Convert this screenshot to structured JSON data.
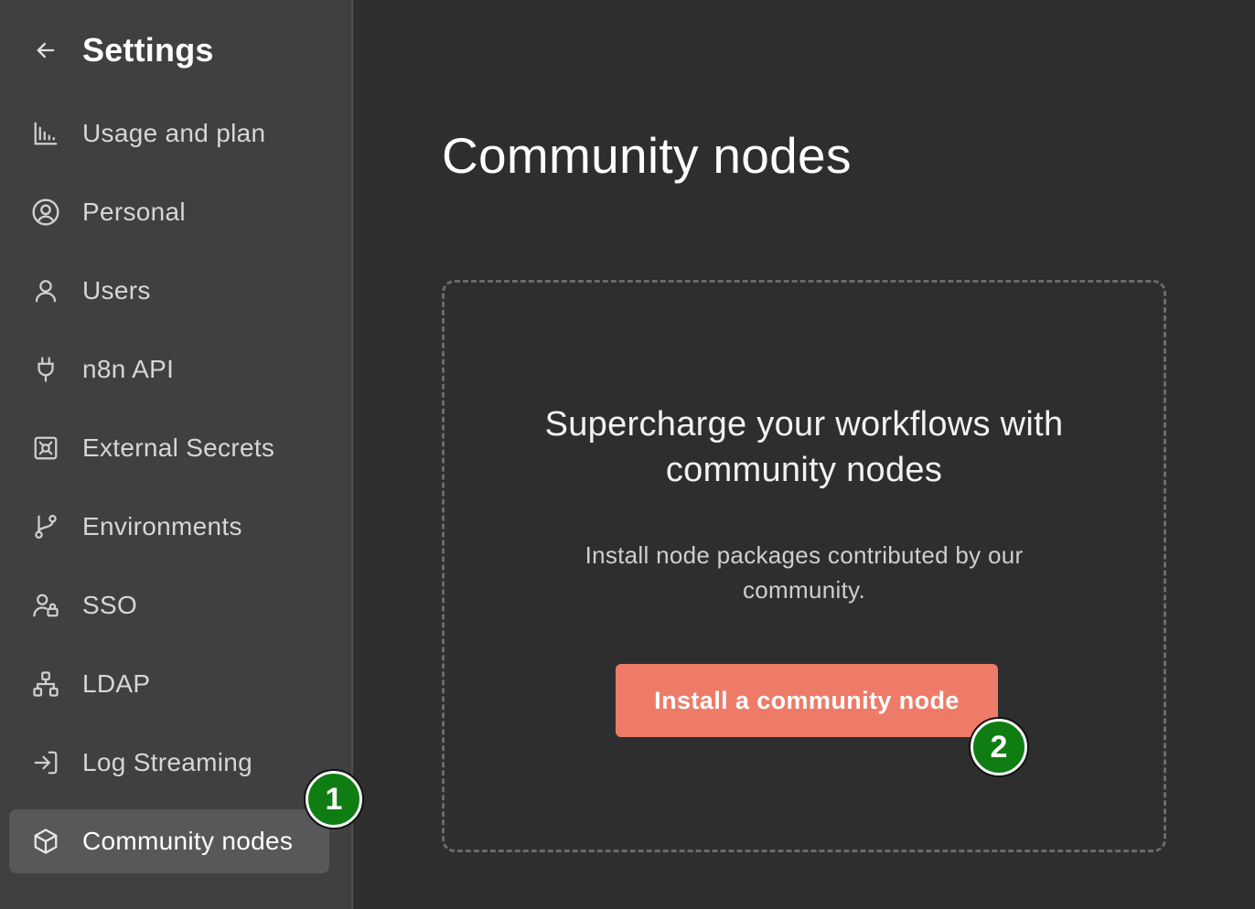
{
  "sidebar": {
    "title": "Settings",
    "back_icon": "arrow-left-icon",
    "items": [
      {
        "label": "Usage and plan",
        "icon": "chart-bar-icon"
      },
      {
        "label": "Personal",
        "icon": "user-circle-icon"
      },
      {
        "label": "Users",
        "icon": "user-icon"
      },
      {
        "label": "n8n API",
        "icon": "plug-icon"
      },
      {
        "label": "External Secrets",
        "icon": "vault-icon"
      },
      {
        "label": "Environments",
        "icon": "git-branch-icon"
      },
      {
        "label": "SSO",
        "icon": "user-lock-icon"
      },
      {
        "label": "LDAP",
        "icon": "network-icon"
      },
      {
        "label": "Log Streaming",
        "icon": "sign-in-icon"
      },
      {
        "label": "Community nodes",
        "icon": "cube-icon",
        "active": true
      }
    ]
  },
  "main": {
    "title": "Community nodes",
    "empty_state": {
      "heading": "Supercharge your workflows with community nodes",
      "description": "Install node packages contributed by our community.",
      "button_label": "Install a community node"
    }
  },
  "markers": [
    "1",
    "2"
  ],
  "colors": {
    "sidebar_bg": "#404042",
    "main_bg": "#2e2e2e",
    "active_item_bg": "#58585a",
    "primary_button": "#ee7b68",
    "marker_green": "#0f7d12"
  }
}
